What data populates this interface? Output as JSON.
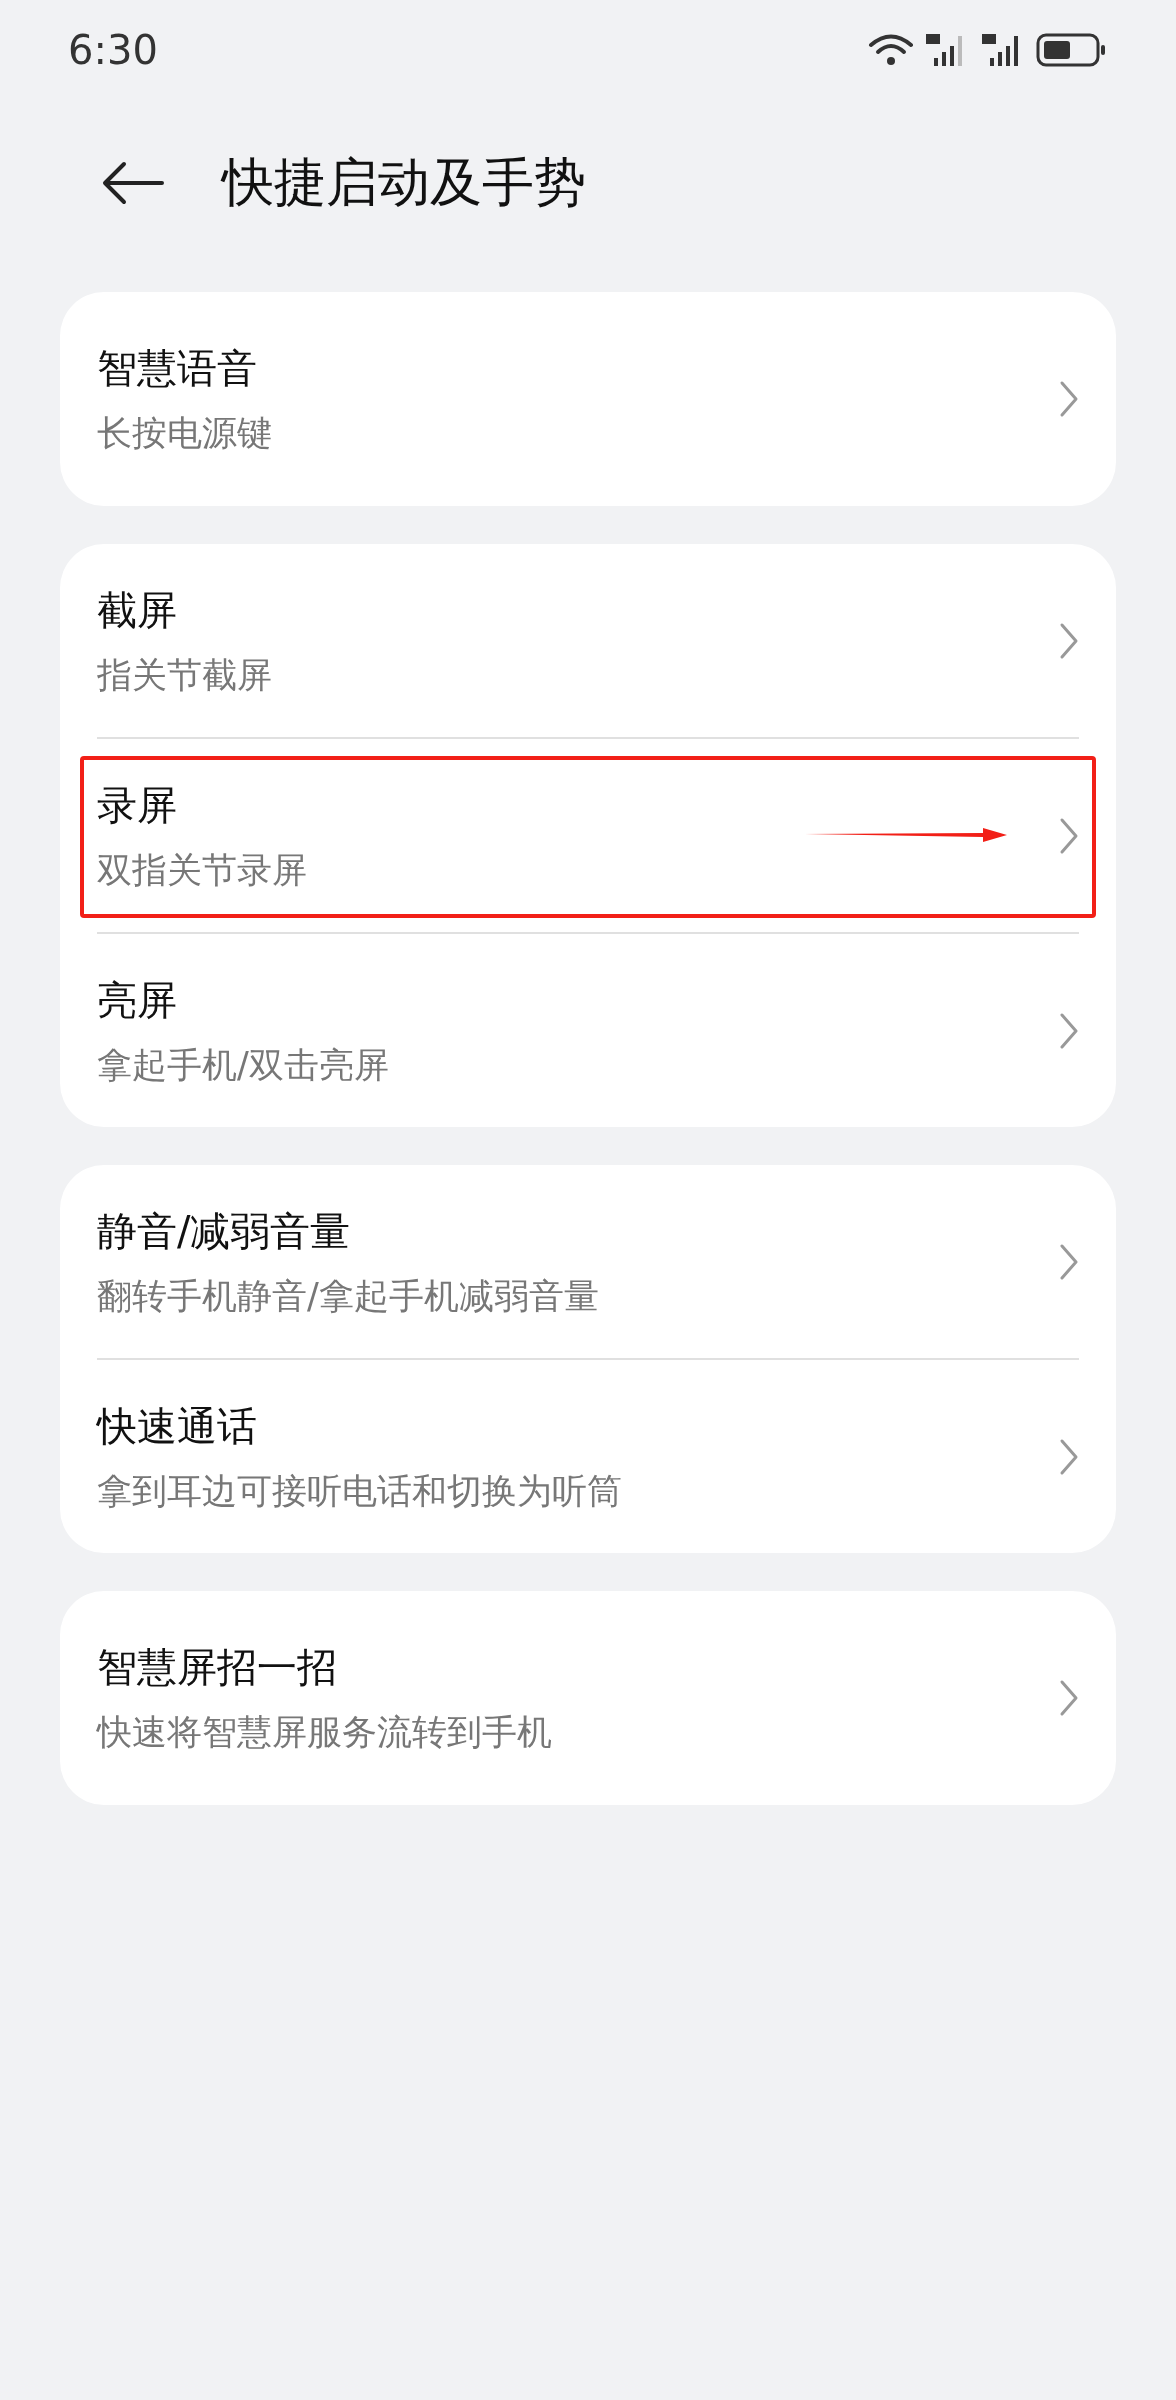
{
  "status_bar": {
    "time": "6:30"
  },
  "header": {
    "title": "快捷启动及手势"
  },
  "groups": [
    {
      "items": [
        {
          "title": "智慧语音",
          "subtitle": "长按电源键",
          "highlighted": false
        }
      ]
    },
    {
      "items": [
        {
          "title": "截屏",
          "subtitle": "指关节截屏",
          "highlighted": false
        },
        {
          "title": "录屏",
          "subtitle": "双指关节录屏",
          "highlighted": true
        },
        {
          "title": "亮屏",
          "subtitle": "拿起手机/双击亮屏",
          "highlighted": false
        }
      ]
    },
    {
      "items": [
        {
          "title": "静音/减弱音量",
          "subtitle": "翻转手机静音/拿起手机减弱音量",
          "highlighted": false
        },
        {
          "title": "快速通话",
          "subtitle": "拿到耳边可接听电话和切换为听筒",
          "highlighted": false
        }
      ]
    },
    {
      "items": [
        {
          "title": "智慧屏招一招",
          "subtitle": "快速将智慧屏服务流转到手机",
          "highlighted": false
        }
      ]
    }
  ]
}
